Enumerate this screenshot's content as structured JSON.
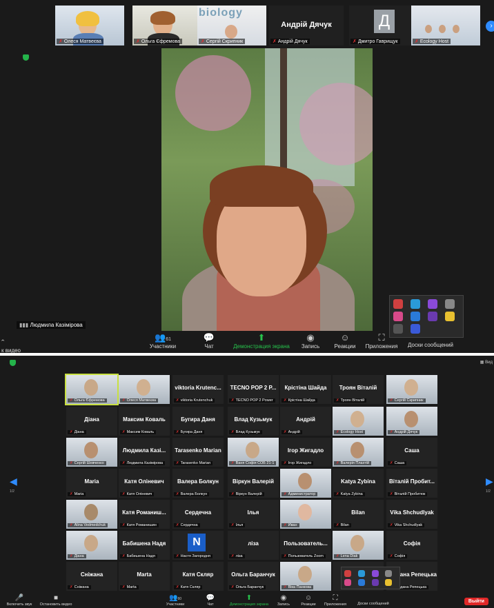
{
  "colors": {
    "accent_green": "#27c24c",
    "mic_red": "#e03030",
    "arrow_blue": "#2f8cff",
    "leave_red": "#e02828"
  },
  "top": {
    "thumbs": [
      {
        "name": "Олеся Матвеєва",
        "type": "video"
      },
      {
        "name": "Ольга Єфремова",
        "type": "video"
      },
      {
        "name": "Сергій Скрипник",
        "type": "video",
        "overlay": "biology"
      },
      {
        "name": "Андрій Дячук",
        "type": "text",
        "display": "Андрій Дячук"
      },
      {
        "name": "Дмитро Гаврищук",
        "type": "letter",
        "letter": "Д"
      },
      {
        "name": "Ecology Host",
        "type": "video"
      }
    ],
    "speaker_name": "Людмила Казімірова",
    "toolbar": {
      "left_label": "к видео",
      "participants": {
        "label": "Участники",
        "count": "61"
      },
      "chat": "Чат",
      "share": "Демонстрация экрана",
      "record": "Запись",
      "reactions": "Реакции",
      "apps": "Приложения",
      "whiteboards": "Доски сообщений"
    }
  },
  "bottom": {
    "page_left": "1/2",
    "page_right": "1/2",
    "view_label": "Вид",
    "tiles": [
      [
        "Ольга Єфремова|v",
        "Олеся Матвеєва|v",
        "viktoria Krutenc...|viktoria Krutenchuk",
        "TECNO POP 2 P...|TECNO POP 2 Power",
        "Крістіна Шайда|Крістіна Шайда",
        "Троян Віталій|Троян Віталій",
        "Сергій Скрипник|v"
      ],
      [
        "Діана|Діана",
        "Максим Коваль|Максим Коваль",
        "Бугира Даня|Бугира Даня",
        "Влад Кузьмук|Влад Кузьмук",
        "Андрій|Андрій",
        "Ecology Host|v",
        "Андрій Дячук|v"
      ],
      [
        "Сергій Шевченко|v",
        "Людмила Казі...|Людмила Казімірова",
        "Tarasenko Marian|Tarasenko Marian",
        "Ваня Софія СОБ 21-1|v",
        "Ігор Жигадло|Ігор Жигадло",
        "Валерія Плахтій|v",
        "Саша|Саша"
      ],
      [
        "Maria|Maria",
        "Катя Оліневич|Катя Оліневич",
        "Валера Болкун|Валера Болкун",
        "Віркун Валерій|Віркун Валерій",
        "Администратор|v",
        "Katya Zybina|Katya Zybina",
        "Віталій Пробит...|Віталій Пробитюк"
      ],
      [
        "Alina Vedmedchuk|v",
        "Катя Романиш...|Катя Романишин",
        "Сердечна|Сердечна",
        "Ілья|Ілья",
        "Иван|v",
        "Bilan|Bilan",
        "Vika Shchudlyak|Vika Shchudlyak"
      ],
      [
        "Діана|v",
        "Бабишена Надя|Бабишена Надя",
        "Настя Загородня|N",
        "ліза|ліза",
        "Пользователь...|Пользователь Zoom",
        "Lena Diak|v",
        "Софія|Софія"
      ],
      [
        "Сніжана|Сніжана",
        "Marta|Marta",
        "Катя Скляр|Катя Скляр",
        "Ольга Баранчук|Ольга Баранчук",
        "Віка Панкова|v",
        "|apps",
        "Богдана Репецька|Богдана Репецька"
      ]
    ],
    "last_partial_title": "огдана Репец...",
    "toolbar": {
      "unmute": "Включить звук",
      "start_video": "Остановить видео",
      "participants": {
        "label": "Участники",
        "count": "60"
      },
      "chat": "Чат",
      "share": "Демонстрация экрана",
      "record": "Запись",
      "reactions": "Реакции",
      "apps": "Приложения",
      "whiteboards": "Доски сообщений",
      "leave": "Выйти"
    }
  }
}
